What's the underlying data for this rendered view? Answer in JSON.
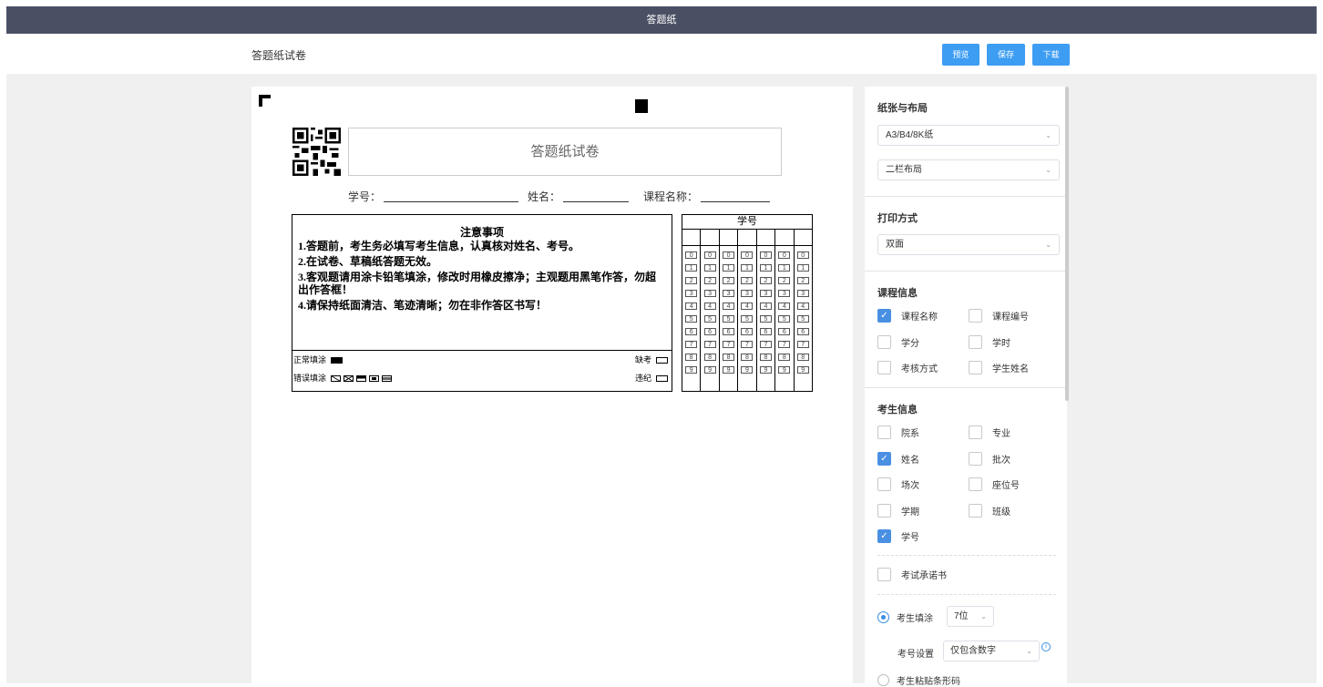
{
  "topbar": {
    "title": "答题纸"
  },
  "header": {
    "title": "答题纸试卷",
    "preview_label": "预览",
    "save_label": "保存",
    "download_label": "下载"
  },
  "paper": {
    "exam_title": "答题纸试卷",
    "info_fields": {
      "student_id": "学号：",
      "name": "姓名：",
      "course": "课程名称："
    },
    "notes": {
      "title": "注意事项",
      "lines": [
        "1.答题前，考生务必填写考生信息，认真核对姓名、考号。",
        "2.在试卷、草稿纸答题无效。",
        "3.客观题请用涂卡铅笔填涂，修改时用橡皮擦净；主观题用黑笔作答，勿超出作答框！",
        "4.请保持纸面清洁、笔迹清晰；勿在非作答区书写！"
      ],
      "normal_fill": "正常填涂",
      "wrong_fill": "错误填涂",
      "absent": "缺考",
      "violation": "违纪"
    },
    "id_grid": {
      "title": "学号",
      "digits": [
        "0",
        "1",
        "2",
        "3",
        "4",
        "5",
        "6",
        "7",
        "8",
        "9"
      ]
    }
  },
  "panel": {
    "paper_layout": {
      "title": "纸张与布局",
      "paper_size": "A3/B4/8K纸",
      "layout": "二栏布局"
    },
    "print": {
      "title": "打印方式",
      "mode": "双面"
    },
    "course_info": {
      "title": "课程信息",
      "items": [
        {
          "label": "课程名称",
          "checked": true
        },
        {
          "label": "课程编号",
          "checked": false
        },
        {
          "label": "学分",
          "checked": false
        },
        {
          "label": "学时",
          "checked": false
        },
        {
          "label": "考核方式",
          "checked": false
        },
        {
          "label": "学生姓名",
          "checked": false
        }
      ]
    },
    "student_info": {
      "title": "考生信息",
      "items": [
        {
          "label": "院系",
          "checked": false
        },
        {
          "label": "专业",
          "checked": false
        },
        {
          "label": "姓名",
          "checked": true
        },
        {
          "label": "批次",
          "checked": false
        },
        {
          "label": "场次",
          "checked": false
        },
        {
          "label": "座位号",
          "checked": false
        },
        {
          "label": "学期",
          "checked": false
        },
        {
          "label": "班级",
          "checked": false
        },
        {
          "label": "学号",
          "checked": true
        }
      ],
      "pledge": "考试承诺书",
      "fill_option": "考生填涂",
      "digits_value": "7位",
      "id_setting_label": "考号设置",
      "id_setting_value": "仅包含数字",
      "barcode_option": "考生粘贴条形码"
    }
  }
}
